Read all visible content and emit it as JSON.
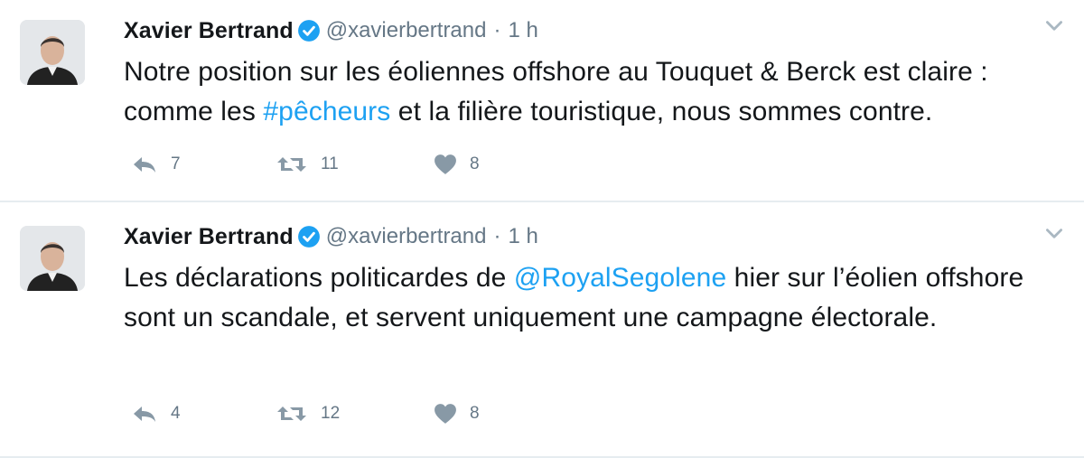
{
  "tweets": [
    {
      "name": "Xavier Bertrand",
      "handle": "@xavierbertrand",
      "separator": "·",
      "time": "1 h",
      "text_parts": [
        "Notre position sur les éoliennes offshore au Touquet & Berck est claire : comme les ",
        "#pêcheurs",
        " et la filière touristique, nous sommes contre."
      ],
      "replies": "7",
      "retweets": "11",
      "likes": "8"
    },
    {
      "name": "Xavier Bertrand",
      "handle": "@xavierbertrand",
      "separator": "·",
      "time": "1 h",
      "text_parts": [
        "Les déclarations politicardes de ",
        "@RoyalSegolene",
        " hier sur l’éolien offshore sont un scandale, et servent uniquement une campagne électorale."
      ],
      "replies": "4",
      "retweets": "12",
      "likes": "8"
    }
  ],
  "colors": {
    "accent": "#1da1f2",
    "muted": "#657786",
    "icon": "#8899a6"
  },
  "icons": [
    "verified-badge-icon",
    "chevron-down-icon",
    "reply-icon",
    "retweet-icon",
    "heart-icon"
  ]
}
